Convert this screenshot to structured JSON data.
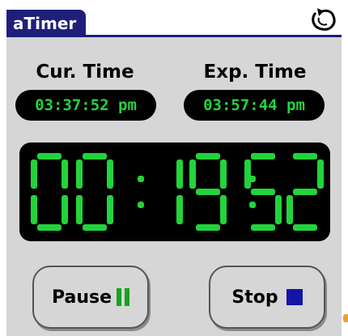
{
  "app": {
    "title": "aTimer"
  },
  "current": {
    "label": "Cur. Time",
    "value": "03:37:52 pm"
  },
  "expiry": {
    "label": "Exp. Time",
    "value": "03:57:44 pm"
  },
  "countdown": {
    "hours": "00",
    "minutes": "19",
    "seconds": "52"
  },
  "buttons": {
    "pause": "Pause",
    "stop": "Stop"
  },
  "colors": {
    "accent": "#1f1f7a",
    "digit": "#22d43a",
    "pause_icon": "#17a21d",
    "stop_icon": "#1414a8"
  },
  "icons": {
    "titlebar": "undo-icon",
    "pause": "pause-icon",
    "stop": "stop-icon"
  }
}
